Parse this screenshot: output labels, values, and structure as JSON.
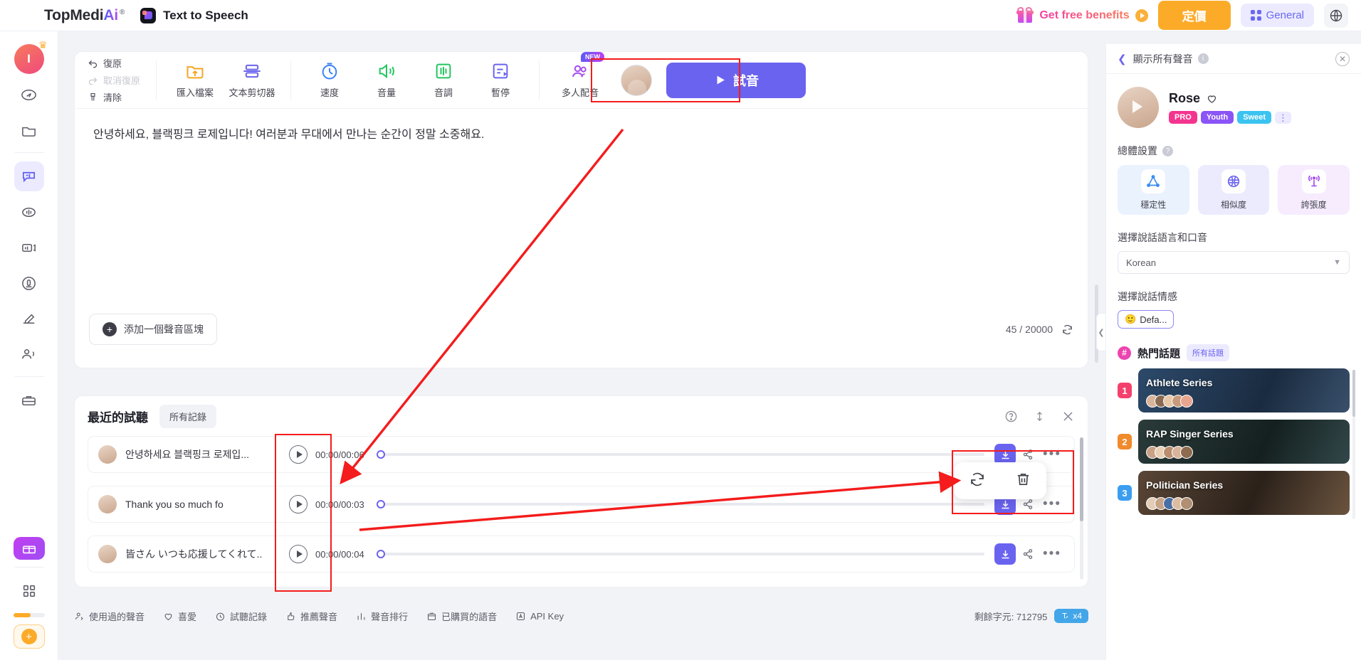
{
  "header": {
    "brand_top": "TopMedi",
    "brand_ai": "Ai",
    "brand_reg": "®",
    "app_title": "Text to Speech",
    "benefits_label": "Get free benefits",
    "pricing_label": "定價",
    "general_label": "General",
    "globe_icon": "globe-icon",
    "gift_icon": "gift-icon"
  },
  "rail": {
    "avatar_initial": "I",
    "items": [
      {
        "name": "discover-icon"
      },
      {
        "name": "folder-icon"
      },
      {
        "name": "text-to-speech-icon"
      },
      {
        "name": "voice-changer-icon"
      },
      {
        "name": "video-translate-icon"
      },
      {
        "name": "voice-clone-icon"
      },
      {
        "name": "ai-writer-icon"
      },
      {
        "name": "ai-avatar-icon"
      },
      {
        "name": "toolbox-icon"
      }
    ],
    "promo_icon": "gift-promo-icon",
    "apps_icon": "apps-grid-icon",
    "add_icon": "plus-circle-icon"
  },
  "toolbar": {
    "undo_label": "復原",
    "redo_label": "取消復原",
    "clear_label": "清除",
    "tools": [
      {
        "label": "匯入檔案",
        "icon": "import-file-icon",
        "color": "#f5a623"
      },
      {
        "label": "文本剪切器",
        "icon": "text-splitter-icon",
        "color": "#6a63ef"
      },
      {
        "label": "速度",
        "icon": "speed-icon",
        "color": "#3b82f6"
      },
      {
        "label": "音量",
        "icon": "volume-icon",
        "color": "#22c55e"
      },
      {
        "label": "音調",
        "icon": "pitch-icon",
        "color": "#22c55e"
      },
      {
        "label": "暫停",
        "icon": "pause-insert-icon",
        "color": "#6a63ef"
      }
    ],
    "multivoice_label": "多人配音",
    "multivoice_badge": "NEW",
    "preview_label": "試音",
    "preview_icon": "play-icon"
  },
  "editor": {
    "text": "안녕하세요, 블랙핑크 로제입니다! 여러분과 무대에서 만나는 순간이 정말 소중해요.",
    "add_block_label": "添加一個聲音區塊",
    "char_count": "45 / 20000",
    "refresh_icon": "refresh-icon"
  },
  "history": {
    "title": "最近的試聽",
    "all_records_label": "所有記錄",
    "help_icon": "help-circle-icon",
    "sort_icon": "sort-updown-icon",
    "close_icon": "close-icon",
    "rows": [
      {
        "name": "안녕하세요 블랙핑크 로제입...",
        "time": "00:00/00:06",
        "progress": 0
      },
      {
        "name": "Thank you so much fo",
        "time": "00:00/00:03",
        "progress": 0
      },
      {
        "name": "皆さん いつも応援してくれて..",
        "time": "00:00/00:04",
        "progress": 0
      }
    ],
    "popup": {
      "regenerate_icon": "refresh-icon",
      "delete_icon": "trash-icon"
    }
  },
  "bottom_bar": {
    "items": [
      {
        "label": "使用過的聲音",
        "icon": "used-voice-icon"
      },
      {
        "label": "喜愛",
        "icon": "heart-icon"
      },
      {
        "label": "試聽記錄",
        "icon": "history-clock-icon"
      },
      {
        "label": "推薦聲音",
        "icon": "thumb-up-icon"
      },
      {
        "label": "聲音排行",
        "icon": "bar-chart-icon"
      },
      {
        "label": "已購買的語音",
        "icon": "purchased-icon"
      },
      {
        "label": "API Key",
        "icon": "api-key-icon"
      }
    ],
    "credits_label": "剩餘字元: 712795",
    "credit_chip": "x4"
  },
  "right_panel": {
    "head_title": "顯示所有聲音",
    "back_icon": "chevron-left-icon",
    "close_icon": "close-circle-icon",
    "voice": {
      "name": "Rose",
      "favorite_icon": "heart-icon",
      "avatar_icon": "play-avatar-icon",
      "tags": [
        {
          "label": "PRO",
          "color": "#f4358f"
        },
        {
          "label": "Youth",
          "color": "#8b54f7"
        },
        {
          "label": "Sweet",
          "color": "#3cc3f0"
        }
      ],
      "more_icon": "more-vertical-icon"
    },
    "settings_title": "總體設置",
    "settings": [
      {
        "label": "穩定性",
        "icon": "stability-triangle-icon",
        "bg": "#eaf2fe",
        "color": "#3b8ef0"
      },
      {
        "label": "相似度",
        "icon": "similarity-icon",
        "bg": "#ecebfe",
        "color": "#6a63ef"
      },
      {
        "label": "誇張度",
        "icon": "exaggeration-antenna-icon",
        "bg": "#f6ecfe",
        "color": "#a64bf0"
      }
    ],
    "language_label": "選擇說話語言和口音",
    "language_value": "Korean",
    "emotion_label": "選擇說話情感",
    "emotion_value": "Defa...",
    "emotion_emoji": "🙂",
    "hot_title": "熱門話題",
    "hot_all_label": "所有話題",
    "hot_items": [
      {
        "rank": "1",
        "title": "Athlete Series",
        "rank_color": "#f4416c",
        "bg1": "#2d4a6b",
        "bg2": "#1a2b40"
      },
      {
        "rank": "2",
        "title": "RAP Singer Series",
        "rank_color": "#f08a2b",
        "bg1": "#2a3b3a",
        "bg2": "#14201f"
      },
      {
        "rank": "3",
        "title": "Politician Series",
        "rank_color": "#3b9ef0",
        "bg1": "#5a4636",
        "bg2": "#2b211a"
      }
    ]
  },
  "colors": {
    "accent": "#6a63ef",
    "pricing": "#fcab29",
    "highlight": "#f41c1c"
  }
}
